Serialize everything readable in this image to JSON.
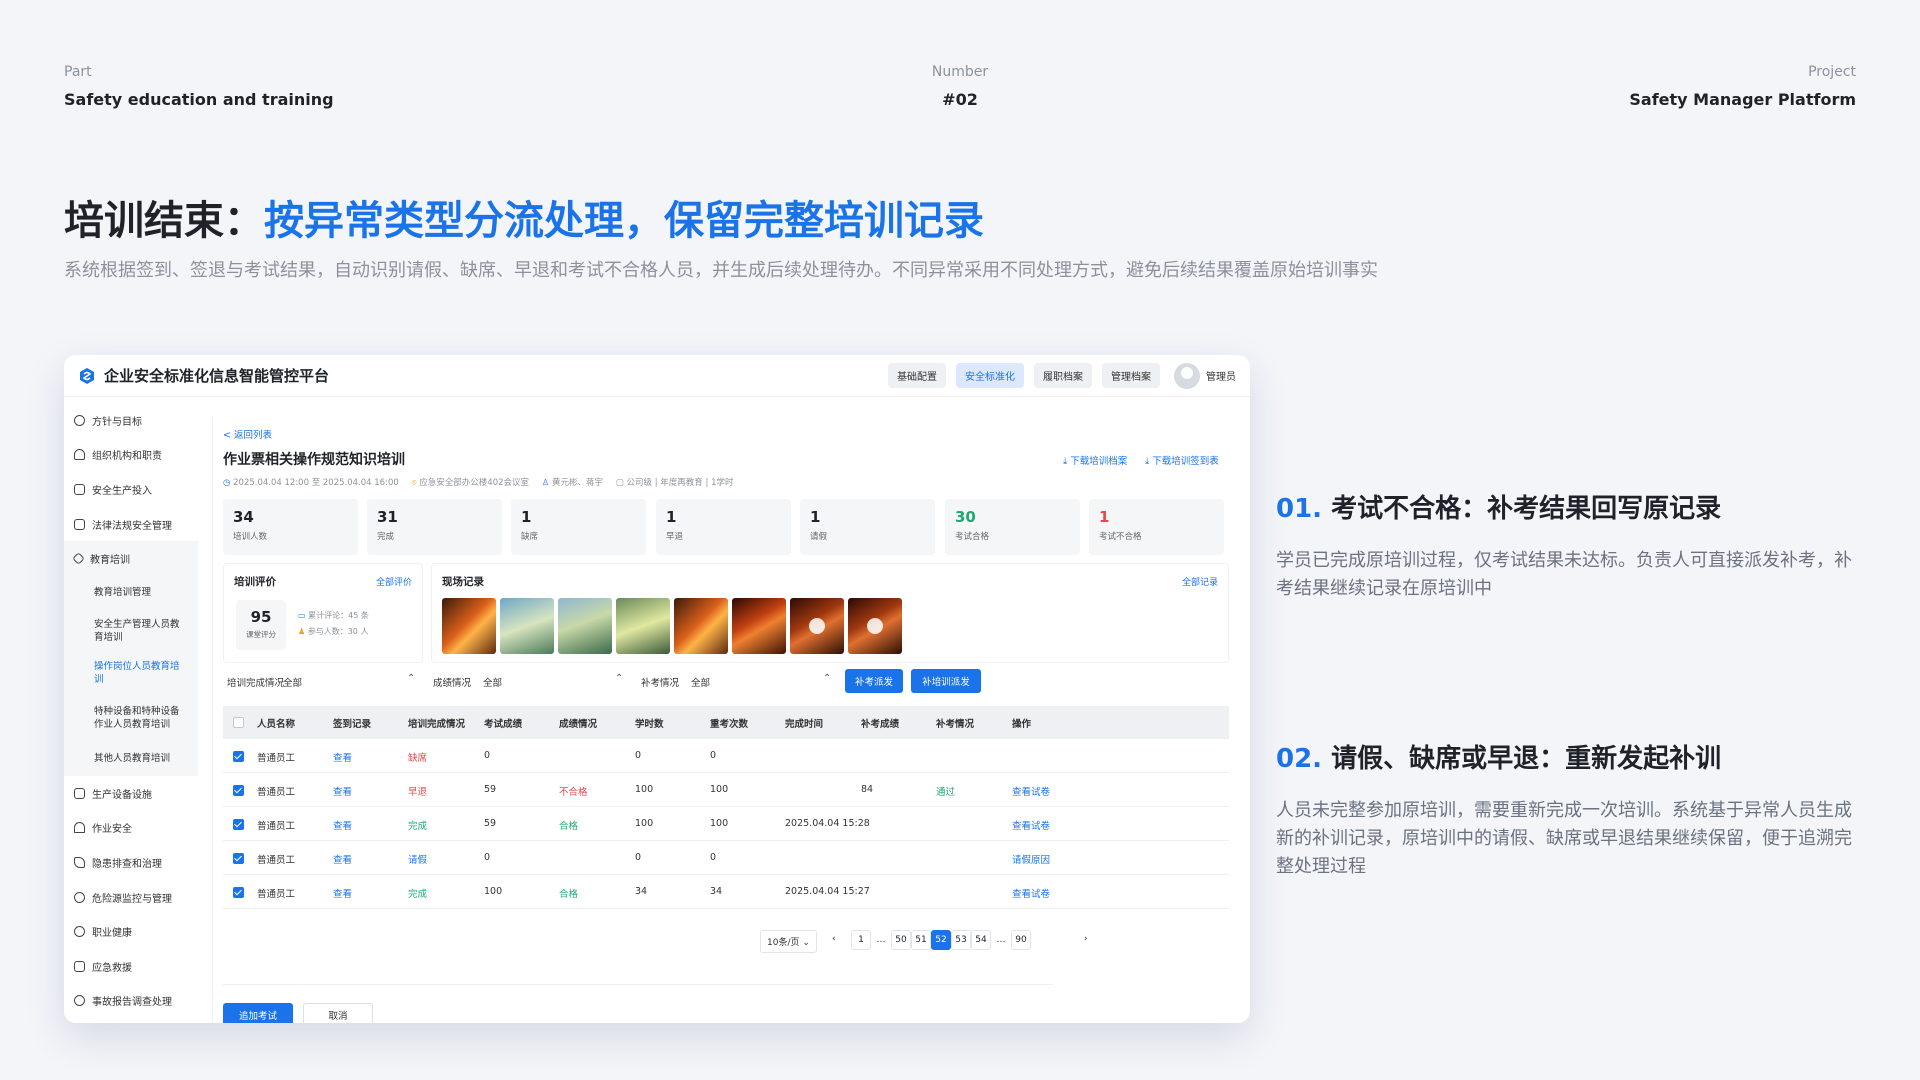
{
  "header": {
    "part_label": "Part",
    "part_value": "Safety education and training",
    "number_label": "Number",
    "number_value": "#02",
    "project_label": "Project",
    "project_value": "Safety Manager Platform"
  },
  "headline": {
    "lead": "培训结束：",
    "accent": "按异常类型分流处理，保留完整培训记录"
  },
  "subtitle": "系统根据签到、签退与考试结果，自动识别请假、缺席、早退和考试不合格人员，并生成后续处理待办。不同异常采用不同处理方式，避免后续结果覆盖原始培训事实",
  "app": {
    "title": "企业安全标准化信息智能管控平台",
    "nav": [
      "基础配置",
      "安全标准化",
      "履职档案",
      "管理档案"
    ],
    "nav_active": 1,
    "user": "管理员",
    "accent": "#1a73e8"
  },
  "sidebar": {
    "items": [
      {
        "label": "方针与目标",
        "icon": "target-icon"
      },
      {
        "label": "组织机构和职责",
        "icon": "user-icon"
      },
      {
        "label": "安全生产投入",
        "icon": "investment-icon"
      },
      {
        "label": "法律法规安全管理",
        "icon": "document-icon"
      },
      {
        "label": "教育培训",
        "icon": "graduation-icon"
      }
    ],
    "sub_items": [
      "教育培训管理",
      "安全生产管理人员教育培训",
      "操作岗位人员教育培训",
      "特种设备和特种设备作业人员教育培训",
      "其他人员教育培训"
    ],
    "sub_active": 2,
    "items_after": [
      {
        "label": "生产设备设施",
        "icon": "equipment-icon"
      },
      {
        "label": "作业安全",
        "icon": "helmet-icon"
      },
      {
        "label": "隐患排查和治理",
        "icon": "warning-icon"
      },
      {
        "label": "危险源监控与管理",
        "icon": "monitor-icon"
      },
      {
        "label": "职业健康",
        "icon": "health-icon"
      },
      {
        "label": "应急救援",
        "icon": "rescue-icon"
      },
      {
        "label": "事故报告调查处理",
        "icon": "report-icon"
      }
    ]
  },
  "page": {
    "back": "< 返回列表",
    "title": "作业票相关操作规范知识培训",
    "download_records": "⤓ 下载培训档案",
    "download_signin": "⤓ 下载培训签到表",
    "time": "2025.04.04 12:00 至 2025.04.04 16:00",
    "location": "应急安全部办公楼402会议室",
    "trainers": "黄元彬、蒋宇",
    "scope": "公司级",
    "category": "年度再教育",
    "hours": "1学时"
  },
  "stats": [
    {
      "value": "34",
      "label": "培训人数",
      "color": "#1f2329"
    },
    {
      "value": "31",
      "label": "完成",
      "color": "#1f2329"
    },
    {
      "value": "1",
      "label": "缺席",
      "color": "#1f2329"
    },
    {
      "value": "1",
      "label": "早退",
      "color": "#1f2329"
    },
    {
      "value": "1",
      "label": "请假",
      "color": "#1f2329"
    },
    {
      "value": "30",
      "label": "考试合格",
      "color": "#1fa971"
    },
    {
      "value": "1",
      "label": "考试不合格",
      "color": "#e5484d"
    }
  ],
  "evaluation": {
    "title": "培训评价",
    "link": "全部评价",
    "score": "95",
    "score_label": "课堂评分",
    "comments": "累计评论：45 条",
    "participants": "参与人数：30 人"
  },
  "records": {
    "title": "现场记录",
    "link": "全部记录"
  },
  "filters": [
    {
      "label": "培训完成情况",
      "value": "全部"
    },
    {
      "label": "成绩情况",
      "value": "全部"
    },
    {
      "label": "补考情况",
      "value": "全部"
    }
  ],
  "buttons": {
    "makeup_exam": "补考派发",
    "makeup_training": "补培训派发",
    "add_exam": "追加考试",
    "cancel": "取消"
  },
  "table": {
    "headers": [
      "人员名称",
      "签到记录",
      "培训完成情况",
      "考试成绩",
      "成绩情况",
      "学时数",
      "重考次数",
      "完成时间",
      "补考成绩",
      "补考情况",
      "操作"
    ],
    "rows": [
      {
        "name": "普通员工",
        "signin": "查看",
        "status": "缺席",
        "status_color": "#e5484d",
        "score": "0",
        "result": "",
        "result_color": "",
        "hours": "0",
        "retakes": "0",
        "done": "",
        "makeup_score": "",
        "makeup_status": "",
        "action": ""
      },
      {
        "name": "普通员工",
        "signin": "查看",
        "status": "早退",
        "status_color": "#e5484d",
        "score": "59",
        "result": "不合格",
        "result_color": "#e5484d",
        "hours": "100",
        "retakes": "100",
        "done": "",
        "makeup_score": "84",
        "makeup_status": "通过",
        "action": "查看试卷"
      },
      {
        "name": "普通员工",
        "signin": "查看",
        "status": "完成",
        "status_color": "#1fa971",
        "score": "59",
        "result": "合格",
        "result_color": "#1fa971",
        "hours": "100",
        "retakes": "100",
        "done": "2025.04.04 15:28",
        "makeup_score": "",
        "makeup_status": "",
        "action": "查看试卷"
      },
      {
        "name": "普通员工",
        "signin": "查看",
        "status": "请假",
        "status_color": "#1a73e8",
        "score": "0",
        "result": "",
        "result_color": "",
        "hours": "0",
        "retakes": "0",
        "done": "",
        "makeup_score": "",
        "makeup_status": "",
        "action": "请假原因"
      },
      {
        "name": "普通员工",
        "signin": "查看",
        "status": "完成",
        "status_color": "#1fa971",
        "score": "100",
        "result": "合格",
        "result_color": "#1fa971",
        "hours": "34",
        "retakes": "34",
        "done": "2025.04.04 15:27",
        "makeup_score": "",
        "makeup_status": "",
        "action": "查看试卷"
      }
    ]
  },
  "pagination": {
    "page_size": "10条/页 ⌄",
    "pages": [
      "1",
      "…",
      "50",
      "51",
      "52",
      "53",
      "54",
      "…",
      "90"
    ],
    "current": "52",
    "prev": "‹",
    "next": "›"
  },
  "sections": [
    {
      "num": "01.",
      "title": "考试不合格：补考结果回写原记录",
      "desc": "学员已完成原培训过程，仅考试结果未达标。负责人可直接派发补考，补考结果继续记录在原培训中"
    },
    {
      "num": "02.",
      "title": "请假、缺席或早退：重新发起补训",
      "desc": "人员未完整参加原培训，需要重新完成一次培训。系统基于异常人员生成新的补训记录，原培训中的请假、缺席或早退结果继续保留，便于追溯完整处理过程"
    }
  ]
}
